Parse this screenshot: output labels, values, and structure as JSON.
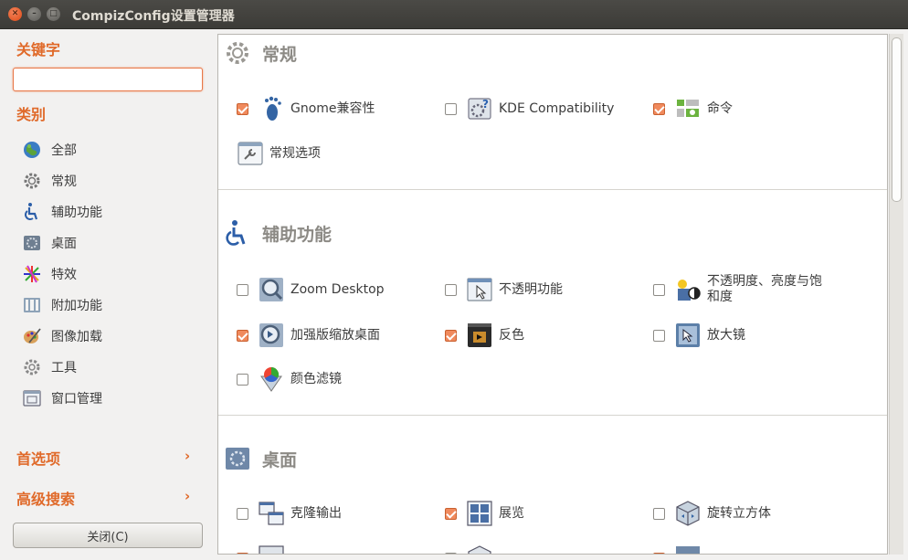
{
  "window": {
    "title": "CompizConfig设置管理器"
  },
  "sidebar": {
    "keyword_heading": "关键字",
    "search_value": "",
    "category_heading": "类别",
    "categories": [
      {
        "label": "全部",
        "icon": "globe-icon"
      },
      {
        "label": "常规",
        "icon": "gear-icon"
      },
      {
        "label": "辅助功能",
        "icon": "accessibility-icon"
      },
      {
        "label": "桌面",
        "icon": "desktop-icon"
      },
      {
        "label": "特效",
        "icon": "effects-icon"
      },
      {
        "label": "附加功能",
        "icon": "extras-icon"
      },
      {
        "label": "图像加载",
        "icon": "image-loading-icon"
      },
      {
        "label": "工具",
        "icon": "utility-icon"
      },
      {
        "label": "窗口管理",
        "icon": "window-management-icon"
      }
    ],
    "preferences_link": "首选项",
    "advanced_search_link": "高级搜索",
    "close_button": "关闭(C)"
  },
  "main": {
    "sections": [
      {
        "title": "常规",
        "items": [
          {
            "label": "Gnome兼容性",
            "checked": true
          },
          {
            "label": "KDE Compatibility",
            "checked": false
          },
          {
            "label": "命令",
            "checked": true
          },
          {
            "label": "常规选项",
            "checked": null
          }
        ]
      },
      {
        "title": "辅助功能",
        "items": [
          {
            "label": "Zoom Desktop",
            "checked": false
          },
          {
            "label": "不透明功能",
            "checked": false
          },
          {
            "label": "不透明度、亮度与饱和度",
            "checked": false
          },
          {
            "label": "加强版缩放桌面",
            "checked": true
          },
          {
            "label": "反色",
            "checked": true
          },
          {
            "label": "放大镜",
            "checked": false
          },
          {
            "label": "颜色滤镜",
            "checked": false
          }
        ]
      },
      {
        "title": "桌面",
        "items": [
          {
            "label": "克隆输出",
            "checked": false
          },
          {
            "label": "展览",
            "checked": true
          },
          {
            "label": "旋转立方体",
            "checked": false
          }
        ]
      }
    ]
  },
  "colors": {
    "accent": "#e06a2a",
    "checkbox_on": "#f08a5d",
    "titlebar": "#3c3b37"
  }
}
